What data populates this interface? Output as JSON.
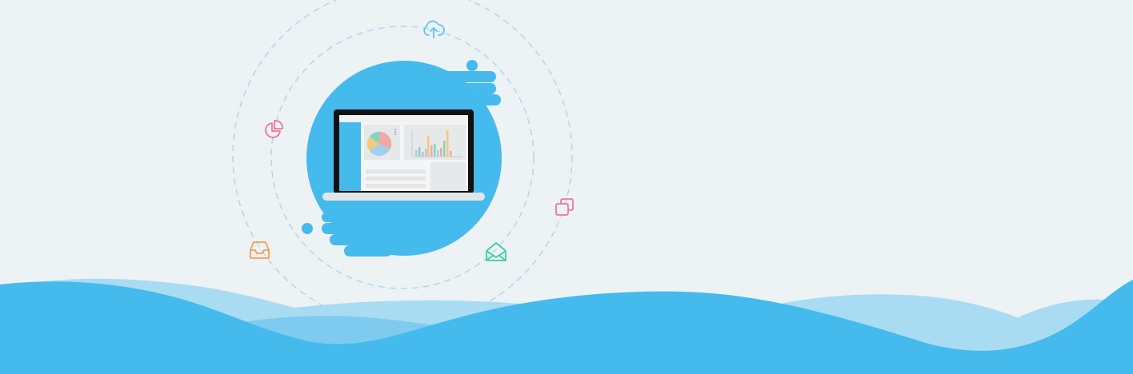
{
  "scene": {
    "background": "#edf2f5",
    "accent": "#45baed",
    "wave_light": "#a9dcf3",
    "wave_mid": "#7fcbf0",
    "orbit_color": "#9fd3ee",
    "icons": [
      {
        "name": "cloud-upload-icon",
        "color": "#5fc6ef"
      },
      {
        "name": "pie-chart-icon",
        "color": "#f27593"
      },
      {
        "name": "copy-icon",
        "color": "#f27593"
      },
      {
        "name": "inbox-icon",
        "color": "#f5a04e"
      },
      {
        "name": "open-mail-icon",
        "color": "#3fcba6"
      }
    ],
    "laptop": {
      "screen_frame": "#111111",
      "sidebar_color": "#45baed",
      "bar_colors": [
        "#f5c97a",
        "#7ed7c1",
        "#f2a9a1",
        "#a2cfee"
      ]
    }
  }
}
